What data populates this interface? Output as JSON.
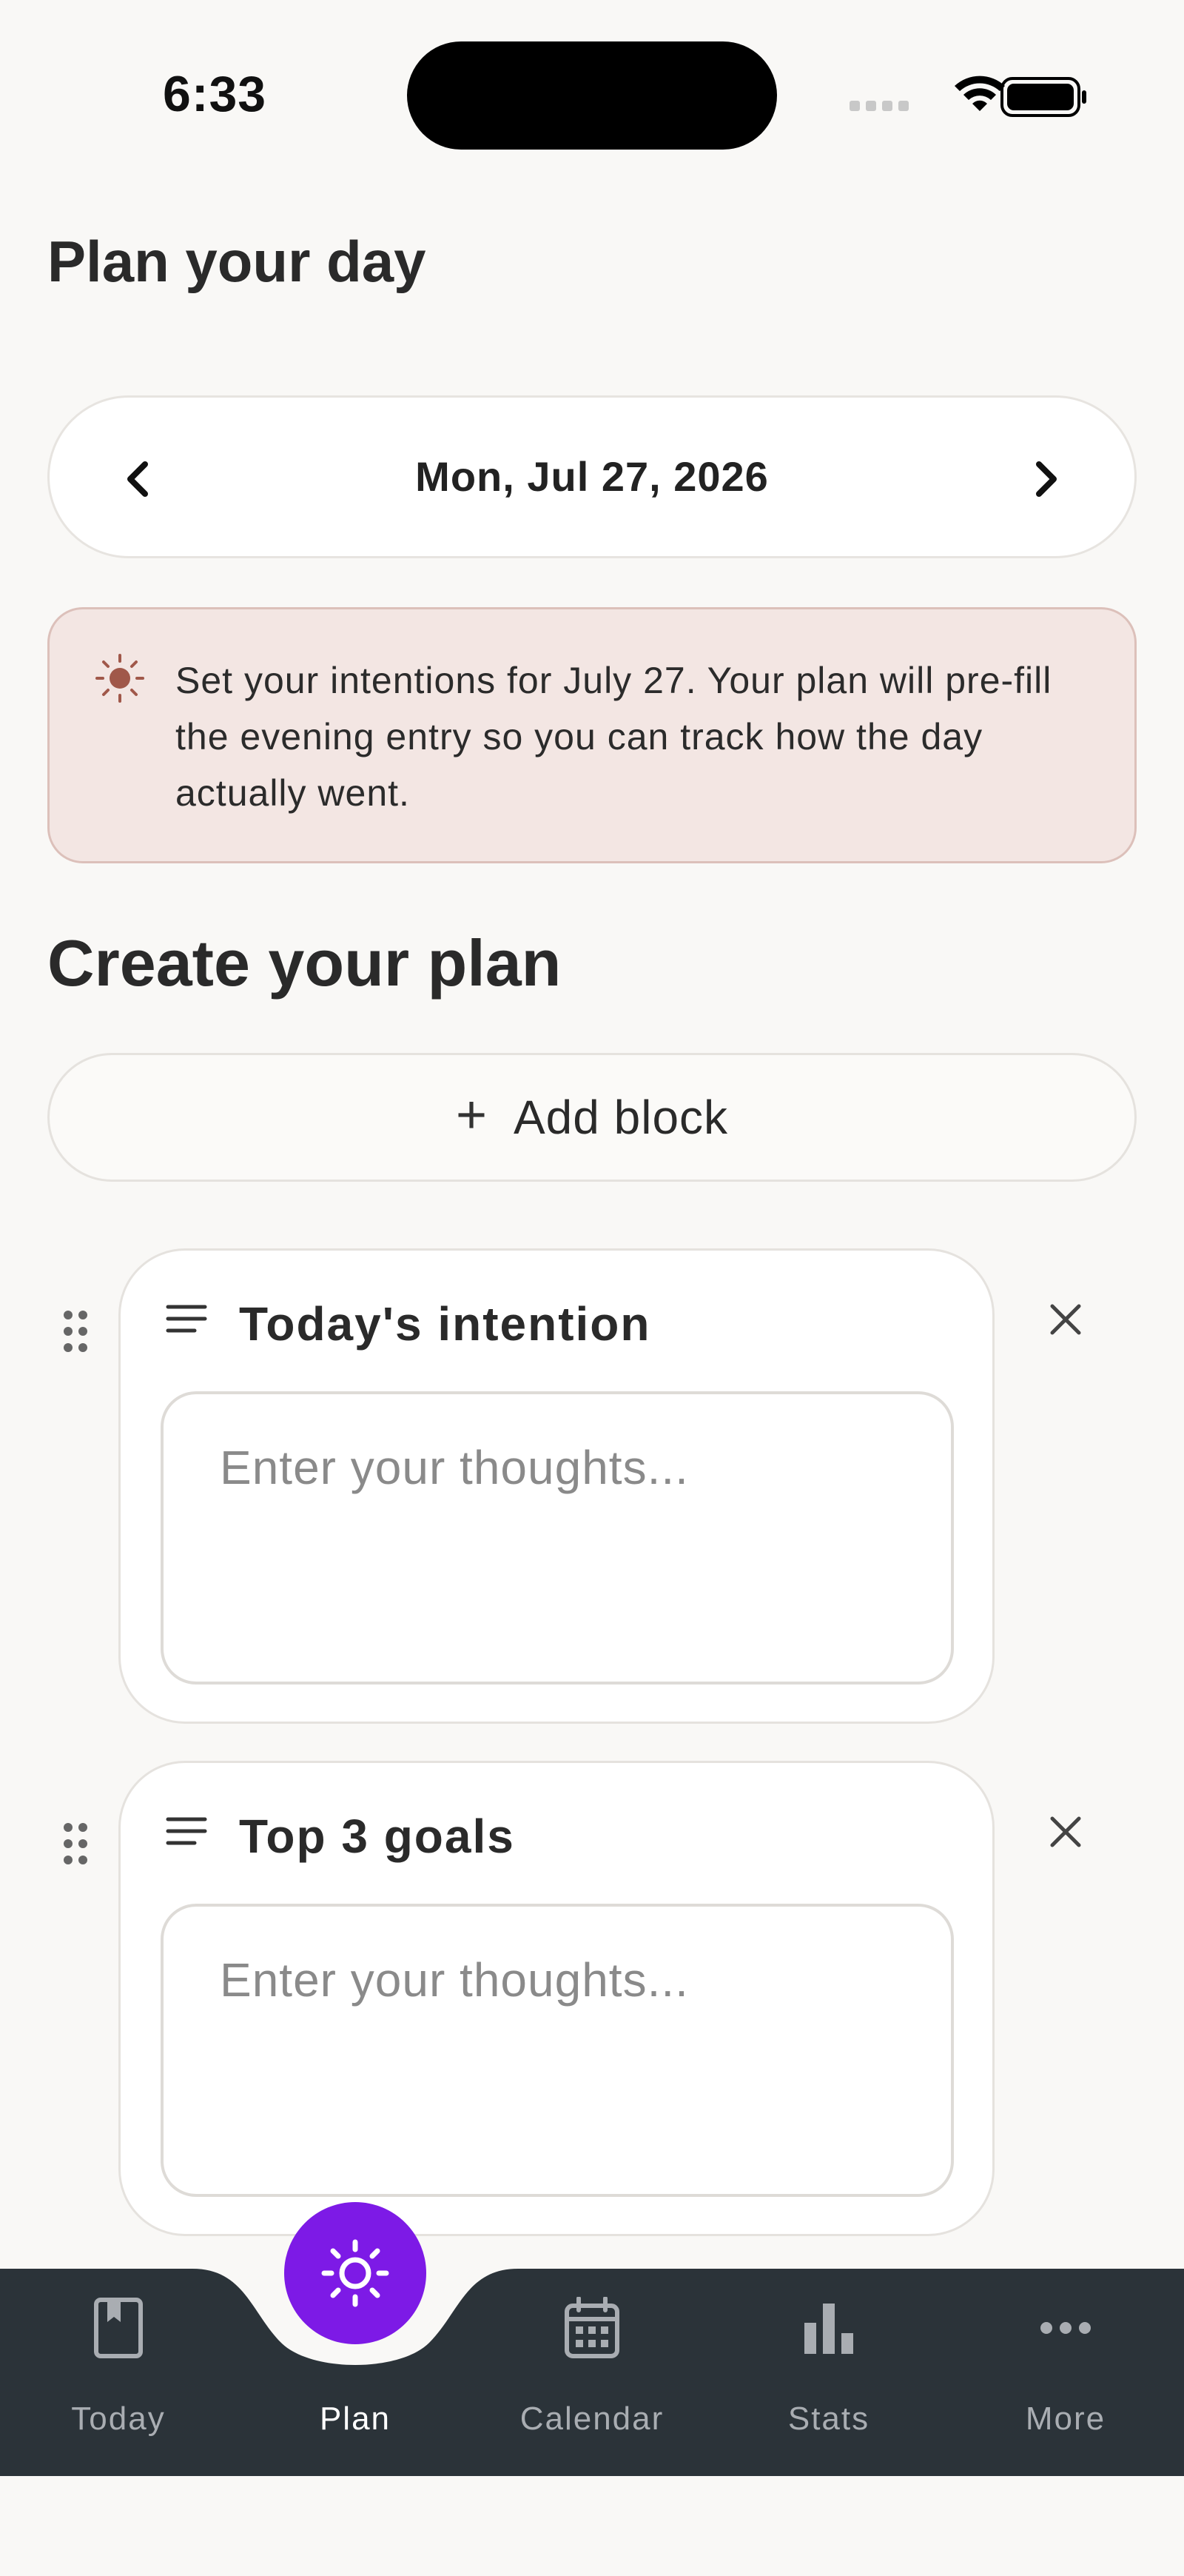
{
  "status_bar": {
    "time": "6:33"
  },
  "page": {
    "title": "Plan your day"
  },
  "date_nav": {
    "date": "Mon, Jul 27, 2026",
    "prev_icon": "chevron-left-icon",
    "next_icon": "chevron-right-icon"
  },
  "banner": {
    "icon": "sun-icon",
    "text": "Set your intentions for July 27. Your plan will pre-fill the evening entry so you can track how the day actually went.",
    "colors": {
      "background": "#f3e6e3",
      "border": "#dcc0ba",
      "icon": "#a0584a"
    }
  },
  "plan": {
    "section_title": "Create your plan",
    "add_block_label": "Add block",
    "blocks": [
      {
        "title": "Today's intention",
        "value": "",
        "placeholder": "Enter your thoughts..."
      },
      {
        "title": "Top 3 goals",
        "value": "",
        "placeholder": "Enter your thoughts..."
      }
    ]
  },
  "bottom_nav": {
    "items": [
      {
        "label": "Today",
        "icon": "journal-icon",
        "active": false
      },
      {
        "label": "Plan",
        "icon": "sun-icon",
        "active": true
      },
      {
        "label": "Calendar",
        "icon": "calendar-icon",
        "active": false
      },
      {
        "label": "Stats",
        "icon": "bar-chart-icon",
        "active": false
      },
      {
        "label": "More",
        "icon": "more-dots-icon",
        "active": false
      }
    ],
    "colors": {
      "background": "#2b3339",
      "accent": "#7d1ae6",
      "inactive": "#a9adb2",
      "active": "#ffffff"
    }
  }
}
